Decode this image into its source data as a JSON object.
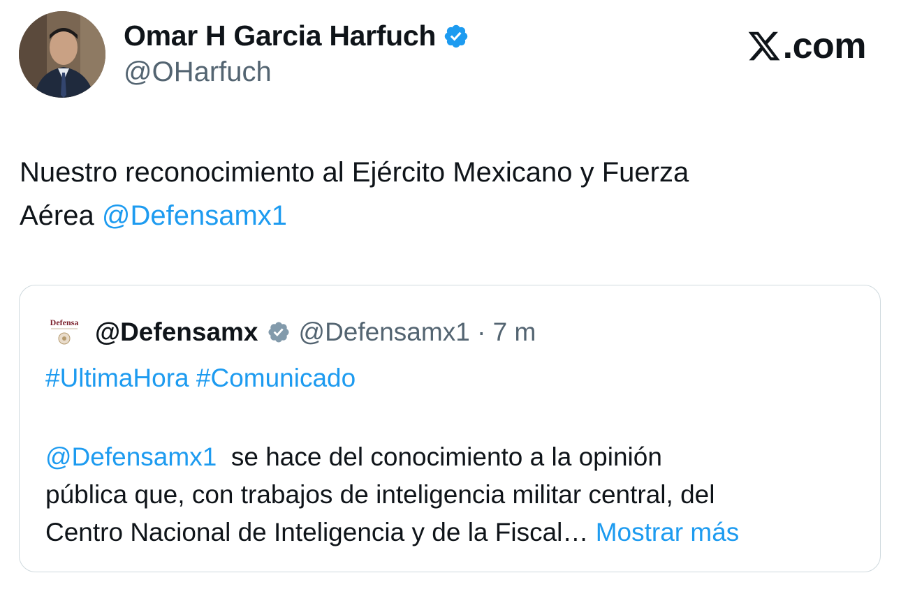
{
  "author": {
    "name": "Omar H Garcia Harfuch",
    "handle": "@OHarfuch"
  },
  "brand": {
    "label": ".com"
  },
  "tweet": {
    "text": "Nuestro reconocimiento al Ejército Mexicano y Fuerza",
    "text_line2": "Aérea",
    "mention": "@Defensamx1"
  },
  "quote": {
    "logo_text": "Defensa",
    "name": "@Defensamx",
    "handle_time": "@Defensamx1 · 7 m",
    "hashtags": "#UltimaHora #Comunicado",
    "mention": "@Defensamx1",
    "line1_rest": "se hace del conocimiento a la opinión",
    "line2": "pública que, con trabajos de inteligencia militar central, del",
    "line3": "Centro Nacional de Inteligencia y de la Fiscal…",
    "show_more": "Mostrar más"
  },
  "colors": {
    "link": "#1d9bf0",
    "verified": "#1d9bf0",
    "verified_gray": "#829aab",
    "text": "#0f1419",
    "muted": "#536471"
  },
  "icons": {
    "verified": "verified-badge-icon",
    "x_logo": "x-logo-icon"
  }
}
